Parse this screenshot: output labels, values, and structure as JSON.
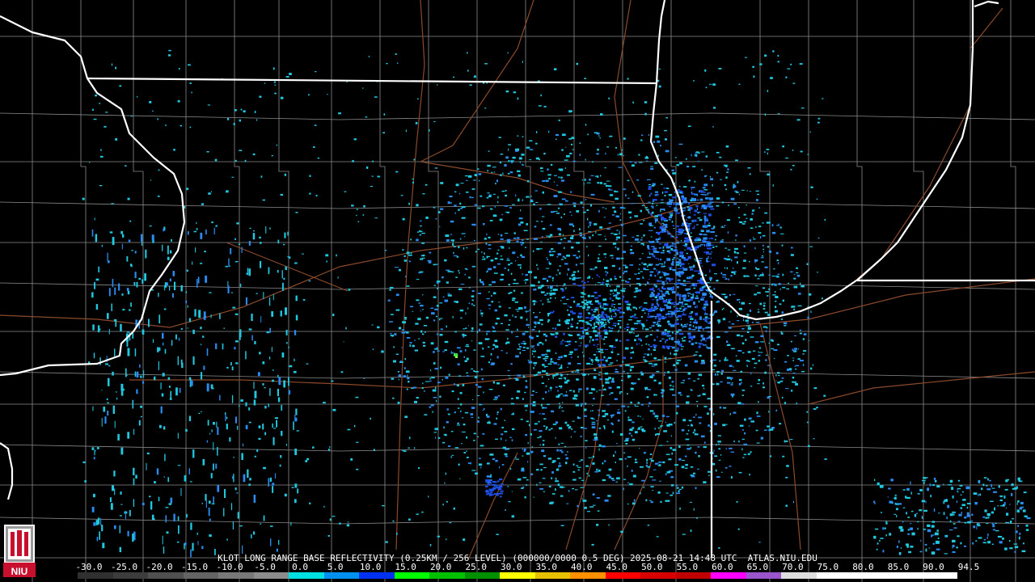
{
  "caption": {
    "text": "KLOT LONG RANGE BASE REFLECTIVITY (0.25KM / 256 LEVEL) (000000/0000 0.5 DEG) 2025-08-21 14:48 UTC  ATLAS.NIU.EDU"
  },
  "legend": {
    "labels": [
      "-30.0",
      "-25.0",
      "-20.0",
      "-15.0",
      "-10.0",
      "-5.0",
      "0.0",
      "5.0",
      "10.0",
      "15.0",
      "20.0",
      "25.0",
      "30.0",
      "35.0",
      "40.0",
      "45.0",
      "50.0",
      "55.0",
      "60.0",
      "65.0",
      "70.0",
      "75.0",
      "80.0",
      "85.0",
      "90.0",
      "94.5"
    ],
    "colors": [
      "#303030",
      "#3c3c3c",
      "#505050",
      "#646464",
      "#787878",
      "#8c8c8c",
      "#00e0e0",
      "#0090f0",
      "#0030f0",
      "#00ff00",
      "#00c000",
      "#009000",
      "#ffff00",
      "#e7c000",
      "#ff9000",
      "#ff0000",
      "#d60000",
      "#c00000",
      "#ff00ff",
      "#9955c9",
      "#dddddd",
      "#ffffff",
      "#ffffff",
      "#ffffff",
      "#ffffff"
    ]
  },
  "logo": {
    "text": "NIU"
  },
  "map_colors": {
    "background": "#000000",
    "state_border": "#ffffff",
    "county_border": "#8a8a8a",
    "highway": "#8b4a2b",
    "echo_light": "#20c8e0",
    "echo_mid": "#2a8cf0",
    "echo_strong": "#1f4fe8",
    "echo_green": "#40e040"
  }
}
